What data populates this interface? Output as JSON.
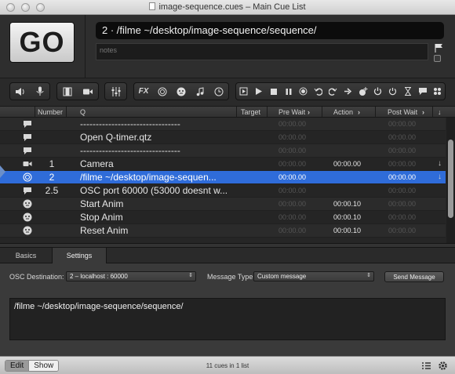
{
  "window": {
    "title": "image-sequence.cues – Main Cue List"
  },
  "go_label": "GO",
  "current_cue_title": "2 · /filme ~/desktop/image-sequence/sequence/",
  "notes_placeholder": "notes",
  "toolbar": {
    "groups": [
      [
        "speaker-icon",
        "microphone-icon"
      ],
      [
        "film-icon",
        "video-camera-icon"
      ],
      [
        "sliders-icon"
      ],
      [
        "fx-label",
        "target-icon",
        "network-icon",
        "music-note-icon",
        "clock-icon"
      ],
      [
        "start-icon",
        "play-icon",
        "stop-icon",
        "pause-icon",
        "record-icon",
        "undo-icon",
        "redo-icon",
        "goto-icon",
        "target-plus-icon",
        "power-icon",
        "reset-icon",
        "hourglass-icon",
        "speech-bubble-icon",
        "grid-icon"
      ]
    ],
    "fx": "FX"
  },
  "columns": {
    "number": "Number",
    "q": "Q",
    "target": "Target",
    "pre_wait": "Pre Wait",
    "action": "Action",
    "post_wait": "Post Wait"
  },
  "cues": [
    {
      "icon": "speech-bubble-icon",
      "number": "",
      "name": "--------------------------------",
      "pre_wait": "00:00.00",
      "action": "",
      "post_wait": "00:00.00",
      "pre_on": false,
      "action_on": false,
      "post_on": false,
      "continue": false,
      "selected": false
    },
    {
      "icon": "speech-bubble-icon",
      "number": "",
      "name": "Open Q-timer.qtz",
      "pre_wait": "00:00.00",
      "action": "",
      "post_wait": "00:00.00",
      "pre_on": false,
      "action_on": false,
      "post_on": false,
      "continue": false,
      "selected": false
    },
    {
      "icon": "speech-bubble-icon",
      "number": "",
      "name": "--------------------------------",
      "pre_wait": "00:00.00",
      "action": "",
      "post_wait": "00:00.00",
      "pre_on": false,
      "action_on": false,
      "post_on": false,
      "continue": false,
      "selected": false
    },
    {
      "icon": "video-camera-icon",
      "number": "1",
      "name": "Camera",
      "pre_wait": "00:00.00",
      "action": "00:00.00",
      "post_wait": "00:00.00",
      "pre_on": false,
      "action_on": true,
      "post_on": false,
      "continue": true,
      "selected": false
    },
    {
      "icon": "target-icon",
      "number": "2",
      "name": "/filme ~/desktop/image-sequen...",
      "pre_wait": "00:00.00",
      "action": "",
      "post_wait": "00:00.00",
      "pre_on": true,
      "action_on": false,
      "post_on": true,
      "continue": true,
      "selected": true
    },
    {
      "icon": "speech-bubble-icon",
      "number": "2.5",
      "name": "OSC port 60000 (53000 doesnt w...",
      "pre_wait": "00:00.00",
      "action": "",
      "post_wait": "00:00.00",
      "pre_on": false,
      "action_on": false,
      "post_on": false,
      "continue": false,
      "selected": false
    },
    {
      "icon": "network-icon",
      "number": "",
      "name": "Start Anim",
      "pre_wait": "00:00.00",
      "action": "00:00.10",
      "post_wait": "00:00.00",
      "pre_on": false,
      "action_on": true,
      "post_on": false,
      "continue": false,
      "selected": false
    },
    {
      "icon": "network-icon",
      "number": "",
      "name": "Stop Anim",
      "pre_wait": "00:00.00",
      "action": "00:00.10",
      "post_wait": "00:00.00",
      "pre_on": false,
      "action_on": true,
      "post_on": false,
      "continue": false,
      "selected": false
    },
    {
      "icon": "network-icon",
      "number": "",
      "name": "Reset Anim",
      "pre_wait": "00:00.00",
      "action": "00:00.10",
      "post_wait": "00:00.00",
      "pre_on": false,
      "action_on": true,
      "post_on": false,
      "continue": false,
      "selected": false
    }
  ],
  "inspector": {
    "tabs": [
      "Basics",
      "Settings"
    ],
    "active_tab": "Settings",
    "osc_destination_label": "OSC Destination:",
    "osc_destination_value": "2 – localhost : 60000",
    "message_type_label": "Message Type:",
    "message_type_value": "Custom message",
    "send_button": "Send Message",
    "message": "/filme ~/desktop/image-sequence/sequence/"
  },
  "bottom": {
    "edit": "Edit",
    "show": "Show",
    "status": "11 cues in 1 list"
  },
  "colors": {
    "selection": "#2f6cd9",
    "go_button": "#e4e4e4"
  }
}
